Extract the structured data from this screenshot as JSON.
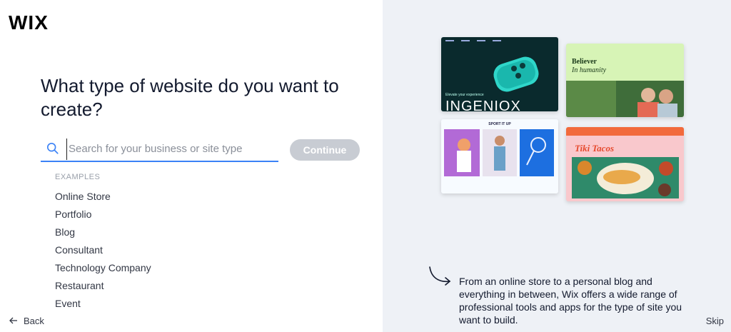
{
  "brand": {
    "logo_text": "WIX"
  },
  "main": {
    "question": "What type of website do you want to create?",
    "search": {
      "placeholder": "Search for your business or site type",
      "value": ""
    },
    "continue_label": "Continue",
    "examples_heading": "EXAMPLES",
    "examples": [
      "Online Store",
      "Portfolio",
      "Blog",
      "Consultant",
      "Technology Company",
      "Restaurant",
      "Event"
    ]
  },
  "footer": {
    "back_label": "Back",
    "skip_label": "Skip"
  },
  "side": {
    "description": "From an online store to a personal blog and everything in between, Wix offers a wide range of professional tools and apps for the type of site you want to build.",
    "templates": {
      "t1_title": "INGENIOX",
      "t1_tag": "Elevate your experience",
      "t2_heading_1": "Believer",
      "t2_heading_2": "In humanity",
      "t3_brand": "SPORT IT UP",
      "t4_title": "Tiki Tacos"
    }
  },
  "colors": {
    "accent": "#3b82f6",
    "continue_disabled": "#c8ccd3",
    "panel_bg": "#eef1f6"
  },
  "icons": {
    "search": "search-icon",
    "back": "arrow-left-icon",
    "decor": "curved-arrow-icon"
  }
}
